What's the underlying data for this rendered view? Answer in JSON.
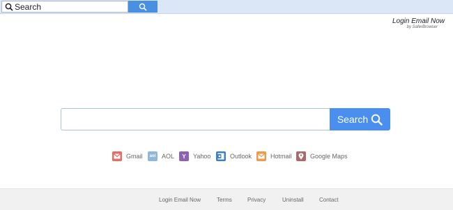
{
  "topbar": {
    "search_placeholder": "Search",
    "search_button_icon": "search-icon"
  },
  "brand": {
    "title": "Login Email Now",
    "subtitle": "by SaferBrowser"
  },
  "main_search": {
    "value": "",
    "button_label": "Search",
    "button_icon": "search-icon"
  },
  "quick_links": [
    {
      "label": "Gmail",
      "icon": "gmail-icon",
      "color": "#e46f62"
    },
    {
      "label": "AOL",
      "icon": "aol-icon",
      "color": "#8fb7d9"
    },
    {
      "label": "Yahoo",
      "icon": "yahoo-icon",
      "color": "#8c62b4"
    },
    {
      "label": "Outlook",
      "icon": "outlook-icon",
      "color": "#3d7fc7"
    },
    {
      "label": "Hotmail",
      "icon": "hotmail-icon",
      "color": "#ef9a4a"
    },
    {
      "label": "Google Maps",
      "icon": "google-maps-icon",
      "color": "#a86a6a"
    }
  ],
  "footer": {
    "links": [
      "Login Email Now",
      "Terms",
      "Privacy",
      "Uninstall",
      "Contact"
    ]
  },
  "colors": {
    "topbar_bg": "#dbe7f7",
    "accent": "#4a8ff0",
    "footer_bg": "#f1f1f1"
  }
}
